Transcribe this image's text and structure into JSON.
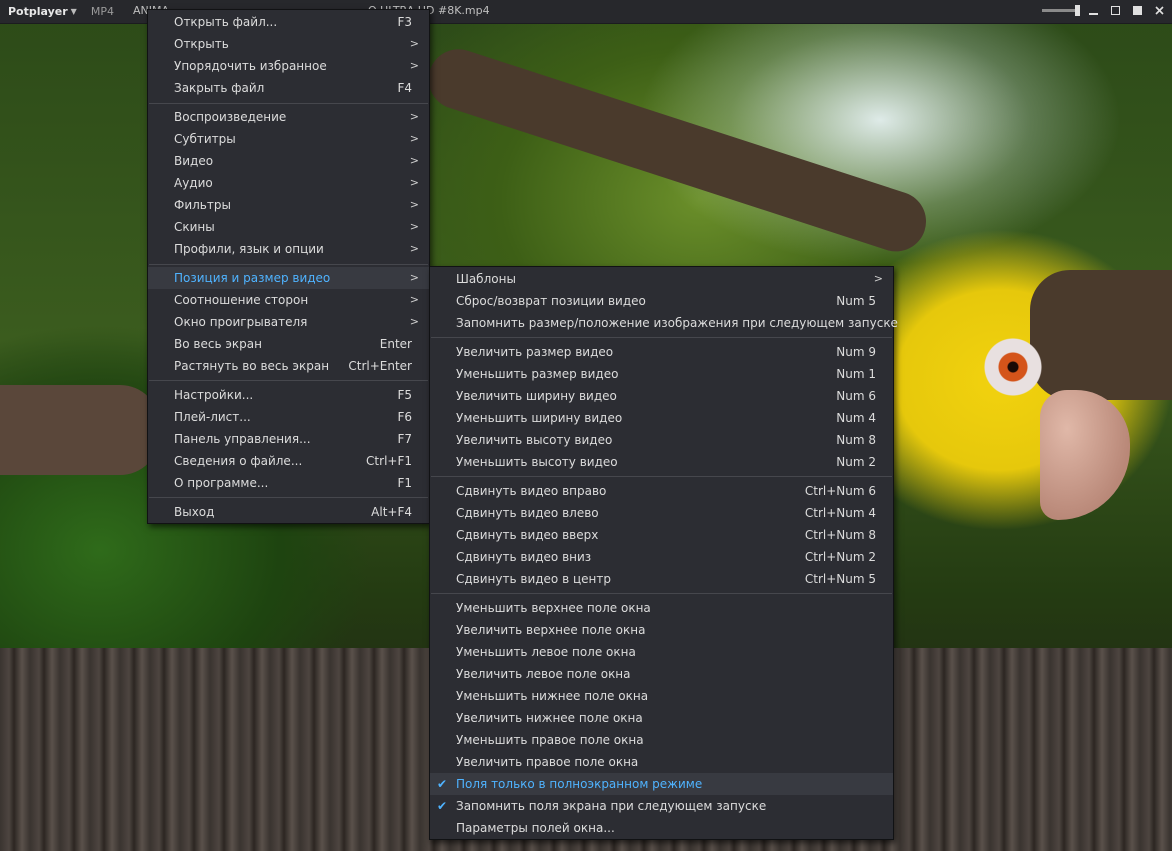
{
  "titlebar": {
    "app_name": "Potplayer",
    "format": "MP4",
    "title_start": "ANIMA",
    "title_end": "O ULTRA HD #8K.mp4"
  },
  "icons": {
    "app_menu_arrow": "caret-down-icon",
    "check": "checkmark-icon",
    "submenu": "chevron-right-icon",
    "window_controls": [
      "minimize-icon",
      "maximize-icon",
      "fullscreen-icon",
      "close-icon"
    ]
  },
  "main_menu": {
    "items": [
      {
        "label": "Открыть файл...",
        "key": "F3"
      },
      {
        "label": "Открыть",
        "sub": ">"
      },
      {
        "label": "Упорядочить избранное",
        "sub": ">"
      },
      {
        "label": "Закрыть файл",
        "key": "F4"
      },
      {
        "label": "Воспроизведение",
        "sub": ">"
      },
      {
        "label": "Субтитры",
        "sub": ">"
      },
      {
        "label": "Видео",
        "sub": ">"
      },
      {
        "label": "Аудио",
        "sub": ">"
      },
      {
        "label": "Фильтры",
        "sub": ">"
      },
      {
        "label": "Скины",
        "sub": ">"
      },
      {
        "label": "Профили, язык и опции",
        "sub": ">"
      },
      {
        "label": "Позиция и размер видео",
        "sub": ">"
      },
      {
        "label": "Соотношение сторон",
        "sub": ">"
      },
      {
        "label": "Окно проигрывателя",
        "sub": ">"
      },
      {
        "label": "Во весь экран",
        "key": "Enter"
      },
      {
        "label": "Растянуть во весь экран",
        "key": "Ctrl+Enter"
      },
      {
        "label": "Настройки...",
        "key": "F5"
      },
      {
        "label": "Плей-лист...",
        "key": "F6"
      },
      {
        "label": "Панель управления...",
        "key": "F7"
      },
      {
        "label": "Сведения о файле...",
        "key": "Ctrl+F1"
      },
      {
        "label": "О программе...",
        "key": "F1"
      },
      {
        "label": "Выход",
        "key": "Alt+F4"
      }
    ]
  },
  "sub_menu": {
    "items": [
      {
        "label": "Шаблоны",
        "sub": ">"
      },
      {
        "label": "Сброс/возврат позиции видео",
        "key": "Num 5"
      },
      {
        "label": "Запомнить размер/положение изображения при следующем запуске"
      },
      {
        "label": "Увеличить размер видео",
        "key": "Num 9"
      },
      {
        "label": "Уменьшить размер видео",
        "key": "Num 1"
      },
      {
        "label": "Увеличить ширину видео",
        "key": "Num 6"
      },
      {
        "label": "Уменьшить ширину видео",
        "key": "Num 4"
      },
      {
        "label": "Увеличить высоту видео",
        "key": "Num 8"
      },
      {
        "label": "Уменьшить высоту видео",
        "key": "Num 2"
      },
      {
        "label": "Сдвинуть видео вправо",
        "key": "Ctrl+Num 6"
      },
      {
        "label": "Сдвинуть видео влево",
        "key": "Ctrl+Num 4"
      },
      {
        "label": "Сдвинуть видео вверх",
        "key": "Ctrl+Num 8"
      },
      {
        "label": "Сдвинуть видео вниз",
        "key": "Ctrl+Num 2"
      },
      {
        "label": "Сдвинуть видео в центр",
        "key": "Ctrl+Num 5"
      },
      {
        "label": "Уменьшить верхнее поле окна"
      },
      {
        "label": "Увеличить верхнее поле окна"
      },
      {
        "label": "Уменьшить левое поле окна"
      },
      {
        "label": "Увеличить левое поле окна"
      },
      {
        "label": "Уменьшить нижнее поле окна"
      },
      {
        "label": "Увеличить нижнее поле окна"
      },
      {
        "label": "Уменьшить правое поле окна"
      },
      {
        "label": "Увеличить правое поле окна"
      },
      {
        "label": "Поля только в полноэкранном режиме",
        "checked": true
      },
      {
        "label": "Запомнить поля экрана при следующем запуске",
        "checked": true
      },
      {
        "label": "Параметры полей окна..."
      }
    ]
  }
}
